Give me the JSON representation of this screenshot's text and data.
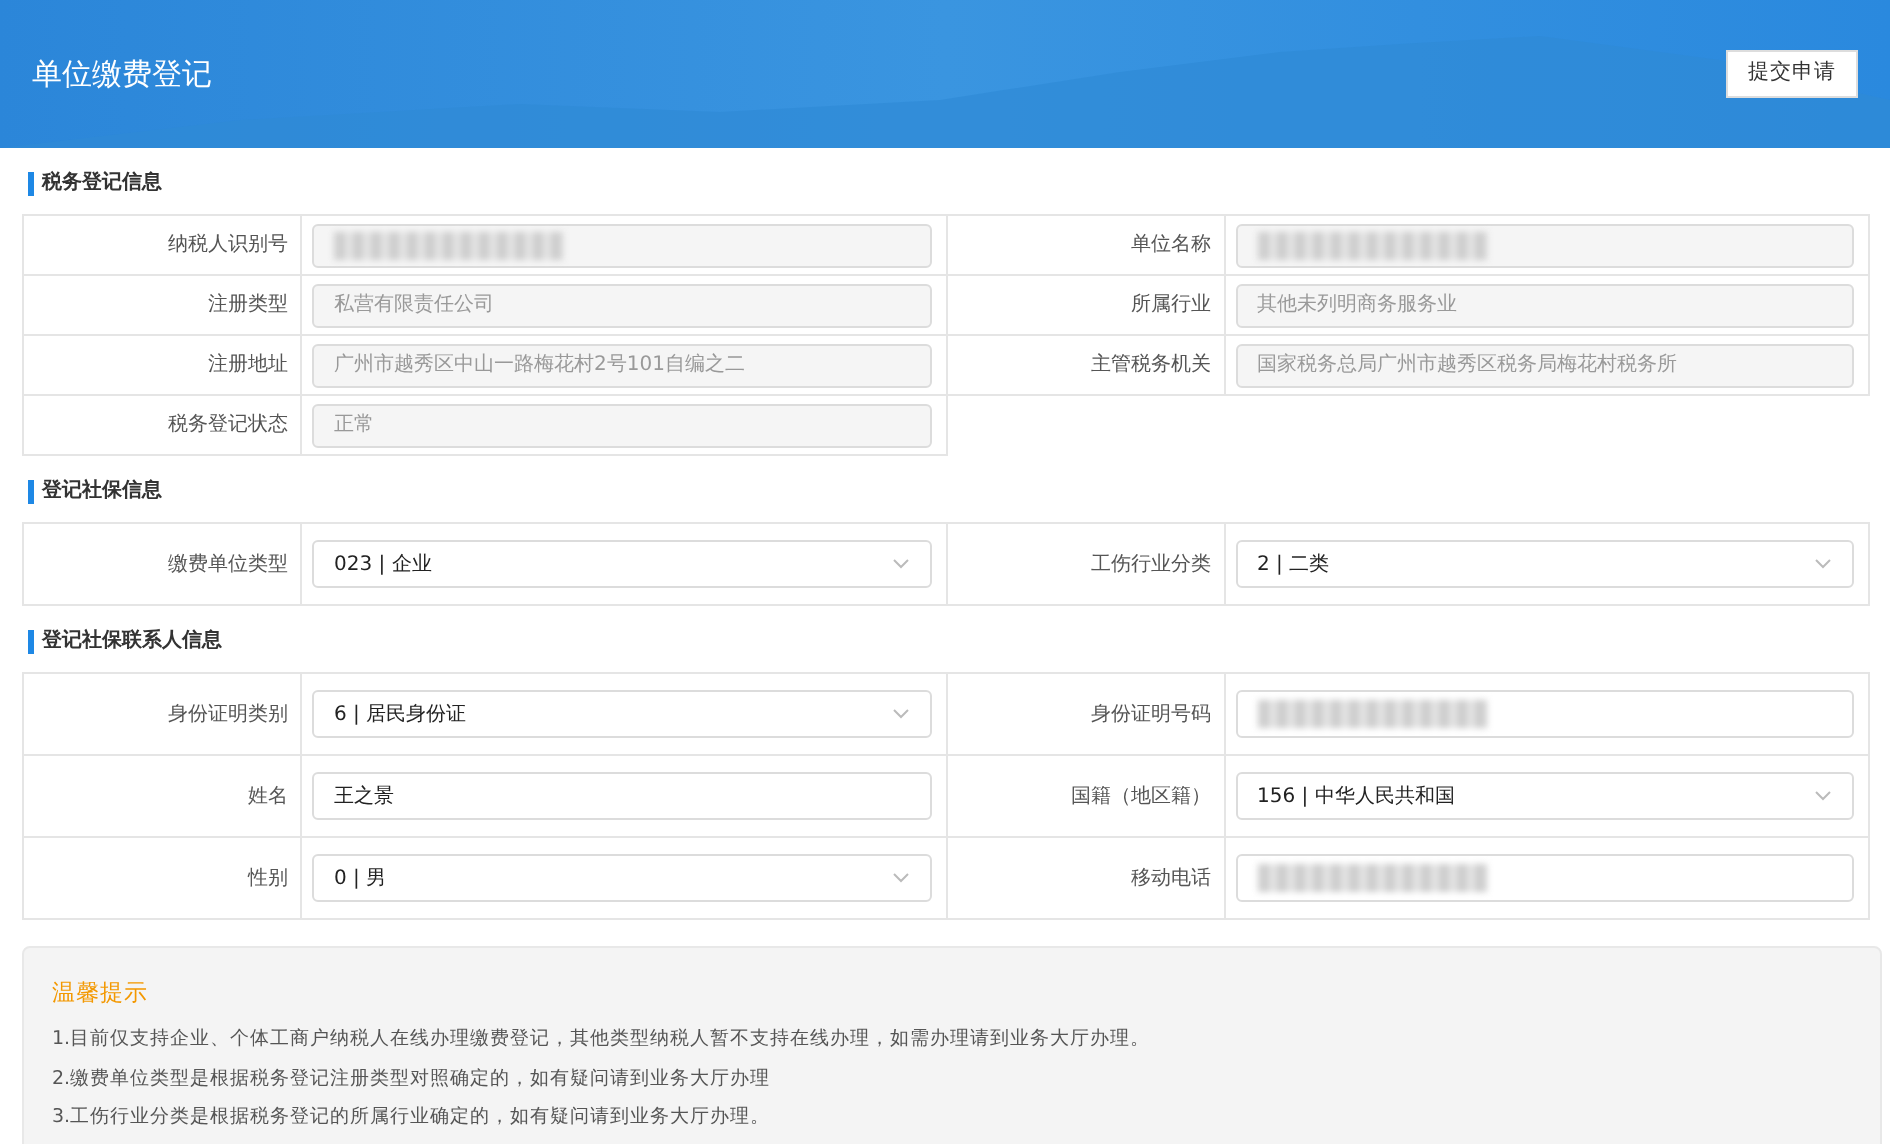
{
  "header": {
    "title": "单位缴费登记",
    "submit_button": "提交申请"
  },
  "sections": [
    {
      "title": "税务登记信息",
      "fields": [
        {
          "label": "纳税人识别号",
          "kind": "masked"
        },
        {
          "label": "单位名称",
          "kind": "masked"
        },
        {
          "label": "注册类型",
          "kind": "readonly",
          "value": "私营有限责任公司"
        },
        {
          "label": "所属行业",
          "kind": "readonly",
          "value": "其他未列明商务服务业"
        },
        {
          "label": "注册地址",
          "kind": "readonly",
          "value": "广州市越秀区中山一路梅花村2号101自编之二"
        },
        {
          "label": "主管税务机关",
          "kind": "readonly",
          "value": "国家税务总局广州市越秀区税务局梅花村税务所"
        },
        {
          "label": "税务登记状态",
          "kind": "readonly",
          "value": "正常"
        }
      ]
    },
    {
      "title": "登记社保信息",
      "fields": [
        {
          "label": "缴费单位类型",
          "kind": "select",
          "value": "023 | 企业"
        },
        {
          "label": "工伤行业分类",
          "kind": "select",
          "value": "2 | 二类"
        }
      ]
    },
    {
      "title": "登记社保联系人信息",
      "fields": [
        {
          "label": "身份证明类别",
          "kind": "select",
          "value": "6 | 居民身份证"
        },
        {
          "label": "身份证明号码",
          "kind": "masked"
        },
        {
          "label": "姓名",
          "kind": "input",
          "value": "王之景"
        },
        {
          "label": "国籍（地区籍）",
          "kind": "select",
          "value": "156 | 中华人民共和国"
        },
        {
          "label": "性别",
          "kind": "select",
          "value": "0 | 男"
        },
        {
          "label": "移动电话",
          "kind": "masked"
        }
      ]
    }
  ],
  "tips": {
    "title": "温馨提示",
    "items": [
      "1.目前仅支持企业、个体工商户纳税人在线办理缴费登记，其他类型纳税人暂不支持在线办理，如需办理请到业务大厅办理。",
      "2.缴费单位类型是根据税务登记注册类型对照确定的，如有疑问请到业务大厅办理",
      "3.工伤行业分类是根据税务登记的所属行业确定的，如有疑问请到业务大厅办理。"
    ]
  }
}
